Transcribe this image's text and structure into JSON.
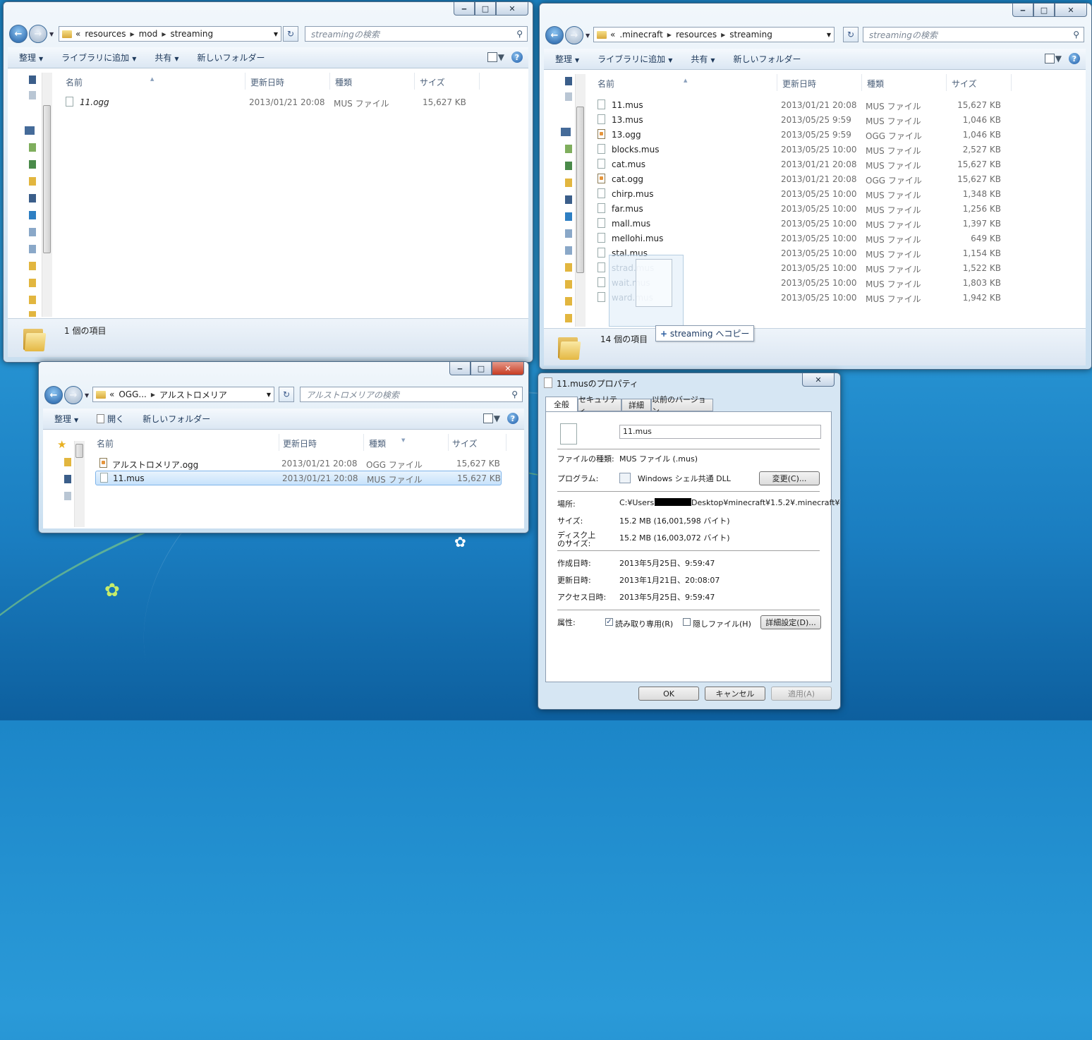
{
  "desktop": {
    "colors": {
      "background": "#1c86c8"
    }
  },
  "win1": {
    "address": {
      "prefix": "«",
      "crumbs": [
        "resources",
        "mod",
        "streaming"
      ]
    },
    "search_placeholder": "streamingの検索",
    "toolbar": {
      "organize": "整理",
      "library": "ライブラリに追加",
      "share": "共有",
      "new_folder": "新しいフォルダー"
    },
    "columns": {
      "name": "名前",
      "date": "更新日時",
      "type": "種類",
      "size": "サイズ"
    },
    "files": [
      {
        "name": "11.ogg",
        "date": "2013/01/21 20:08",
        "type": "MUS ファイル",
        "size": "15,627 KB"
      }
    ],
    "status": "1 個の項目"
  },
  "win2": {
    "address": {
      "prefix": "«",
      "crumbs": [
        ".minecraft",
        "resources",
        "streaming"
      ]
    },
    "search_placeholder": "streamingの検索",
    "toolbar": {
      "organize": "整理",
      "library": "ライブラリに追加",
      "share": "共有",
      "new_folder": "新しいフォルダー"
    },
    "columns": {
      "name": "名前",
      "date": "更新日時",
      "type": "種類",
      "size": "サイズ"
    },
    "files": [
      {
        "name": "11.mus",
        "date": "2013/01/21 20:08",
        "type": "MUS ファイル",
        "size": "15,627 KB"
      },
      {
        "name": "13.mus",
        "date": "2013/05/25 9:59",
        "type": "MUS ファイル",
        "size": "1,046 KB"
      },
      {
        "name": "13.ogg",
        "date": "2013/05/25 9:59",
        "type": "OGG ファイル",
        "size": "1,046 KB"
      },
      {
        "name": "blocks.mus",
        "date": "2013/05/25 10:00",
        "type": "MUS ファイル",
        "size": "2,527 KB"
      },
      {
        "name": "cat.mus",
        "date": "2013/01/21 20:08",
        "type": "MUS ファイル",
        "size": "15,627 KB"
      },
      {
        "name": "cat.ogg",
        "date": "2013/01/21 20:08",
        "type": "OGG ファイル",
        "size": "15,627 KB"
      },
      {
        "name": "chirp.mus",
        "date": "2013/05/25 10:00",
        "type": "MUS ファイル",
        "size": "1,348 KB"
      },
      {
        "name": "far.mus",
        "date": "2013/05/25 10:00",
        "type": "MUS ファイル",
        "size": "1,256 KB"
      },
      {
        "name": "mall.mus",
        "date": "2013/05/25 10:00",
        "type": "MUS ファイル",
        "size": "1,397 KB"
      },
      {
        "name": "mellohi.mus",
        "date": "2013/05/25 10:00",
        "type": "MUS ファイル",
        "size": "649 KB"
      },
      {
        "name": "stal.mus",
        "date": "2013/05/25 10:00",
        "type": "MUS ファイル",
        "size": "1,154 KB"
      },
      {
        "name": "strad.mus",
        "date": "2013/05/25 10:00",
        "type": "MUS ファイル",
        "size": "1,522 KB"
      },
      {
        "name": "wait.mus",
        "date": "2013/05/25 10:00",
        "type": "MUS ファイル",
        "size": "1,803 KB"
      },
      {
        "name": "ward.mus",
        "date": "2013/05/25 10:00",
        "type": "MUS ファイル",
        "size": "1,942 KB"
      }
    ],
    "status": "14 個の項目",
    "drag_tooltip": "streaming へコピー"
  },
  "win3": {
    "address": {
      "prefix": "«",
      "crumbs": [
        "OGG...",
        "アルストロメリア"
      ]
    },
    "search_placeholder": "アルストロメリアの検索",
    "toolbar": {
      "organize": "整理",
      "open": "開く",
      "new_folder": "新しいフォルダー"
    },
    "columns": {
      "name": "名前",
      "date": "更新日時",
      "type": "種類",
      "size": "サイズ"
    },
    "files": [
      {
        "name": "アルストロメリア.ogg",
        "date": "2013/01/21 20:08",
        "type": "OGG ファイル",
        "size": "15,627 KB"
      },
      {
        "name": "11.mus",
        "date": "2013/01/21 20:08",
        "type": "MUS ファイル",
        "size": "15,627 KB"
      }
    ]
  },
  "props": {
    "title": "11.musのプロパティ",
    "tabs": [
      "全般",
      "セキュリティ",
      "詳細",
      "以前のバージョン"
    ],
    "filename": "11.mus",
    "type_label": "ファイルの種類:",
    "type_value": "MUS ファイル (.mus)",
    "program_label": "プログラム:",
    "program_value": "Windows シェル共通 DLL",
    "change_button": "変更(C)...",
    "location_label": "場所:",
    "location_prefix": "C:¥Users¥",
    "location_suffix": "Desktop¥minecraft¥1.5.2¥.minecraft¥",
    "size_label": "サイズ:",
    "size_value": "15.2 MB (16,001,598 バイト)",
    "disk_label_1": "ディスク上",
    "disk_label_2": "のサイズ:",
    "disk_value": "15.2 MB (16,003,072 バイト)",
    "created_label": "作成日時:",
    "created_value": "2013年5月25日、9:59:47",
    "modified_label": "更新日時:",
    "modified_value": "2013年1月21日、20:08:07",
    "accessed_label": "アクセス日時:",
    "accessed_value": "2013年5月25日、9:59:47",
    "attr_label": "属性:",
    "readonly_label": "読み取り専用(R)",
    "readonly_checked": true,
    "hidden_label": "隠しファイル(H)",
    "hidden_checked": false,
    "advanced_button": "詳細設定(D)...",
    "ok": "OK",
    "cancel": "キャンセル",
    "apply": "適用(A)"
  }
}
